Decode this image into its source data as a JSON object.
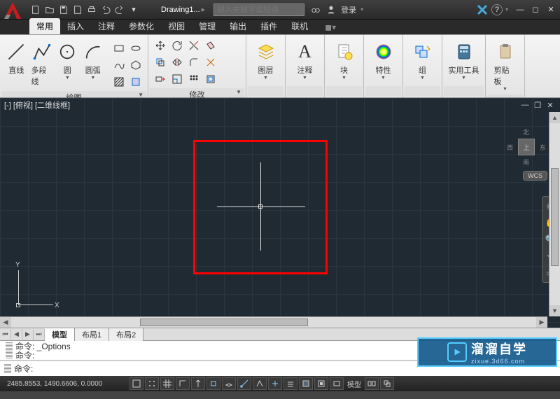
{
  "titlebar": {
    "doc_title": "Drawing1...",
    "qat_dropdown": "▾",
    "search_placeholder": "键入关键字或短语",
    "login_label": "登录",
    "help_label": "?"
  },
  "ribbon": {
    "tabs": [
      "常用",
      "插入",
      "注释",
      "参数化",
      "视图",
      "管理",
      "输出",
      "插件",
      "联机"
    ],
    "active_tab": 0,
    "panels": {
      "draw": {
        "title": "绘图",
        "items": {
          "line": "直线",
          "pline": "多段线",
          "circle": "圆",
          "arc": "圆弧"
        }
      },
      "modify": {
        "title": "修改"
      },
      "layers": {
        "title": "图层"
      },
      "anno": {
        "title": "注释"
      },
      "block": {
        "title": "块"
      },
      "prop": {
        "title": "特性"
      },
      "group": {
        "title": "组"
      },
      "util": {
        "title": "实用工具"
      },
      "clip": {
        "title": "剪贴板"
      }
    }
  },
  "view": {
    "header": "[-] [俯视] [二维线框]",
    "ucs": {
      "x": "X",
      "y": "Y"
    },
    "cube": {
      "top": "上",
      "n": "北",
      "s": "南",
      "e": "东",
      "w": "西"
    },
    "wcs": "WCS"
  },
  "layout_tabs": [
    "模型",
    "布局1",
    "布局2"
  ],
  "cmd": {
    "hist1": "命令: _Options",
    "hist2": "命令:",
    "prompt": "命令:"
  },
  "status": {
    "coords": "2485.8553, 1490.6606, 0.0000",
    "model_label": "模型"
  },
  "watermark": {
    "line1": "溜溜自学",
    "line2": "zixue.3d66.com"
  }
}
